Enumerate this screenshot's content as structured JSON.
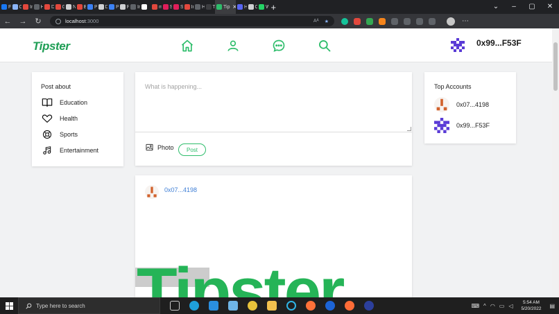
{
  "browser": {
    "tabs": [
      {
        "label": "Fa",
        "color": "#1877f2"
      },
      {
        "label": "Cc",
        "color": "#8ab4f8"
      },
      {
        "label": "In",
        "color": "#e2483d"
      },
      {
        "label": "H",
        "color": "#5f6368"
      },
      {
        "label": "Di",
        "color": "#e2483d"
      },
      {
        "label": "G",
        "color": "#e2483d"
      },
      {
        "label": "N",
        "color": "#cfd0d2"
      },
      {
        "label": "Br",
        "color": "#e2483d"
      },
      {
        "label": "Pr",
        "color": "#3c82f6"
      },
      {
        "label": "Di",
        "color": "#cfd0d2"
      },
      {
        "label": "Pr",
        "color": "#3c82f6"
      },
      {
        "label": "Pr",
        "color": "#cfd0d2"
      },
      {
        "label": "In",
        "color": "#5f6368"
      },
      {
        "label": "",
        "color": "#ffffff"
      },
      {
        "label": "m",
        "color": "#e2483d"
      },
      {
        "label": "Sl",
        "color": "#e01e5a"
      },
      {
        "label": "Sl",
        "color": "#e01e5a"
      },
      {
        "label": "In",
        "color": "#e2483d"
      },
      {
        "label": "H",
        "color": "#5f6368"
      },
      {
        "label": "Ta",
        "color": "#3c3d40"
      }
    ],
    "active_tab": {
      "label": "Tip",
      "color": "#2ebd6b"
    },
    "tail_tabs": [
      {
        "label": "H",
        "color": "#5865f2"
      },
      {
        "label": "Cl",
        "color": "#cfd0d2"
      },
      {
        "label": "W",
        "color": "#25d366"
      }
    ],
    "new_tab": "+",
    "window_controls": [
      "⌄",
      "–",
      "▢",
      "✕"
    ],
    "url_host": "localhost",
    "url_port": ":3000",
    "omni_icons": [
      "Aᴬ",
      "★"
    ]
  },
  "header": {
    "logo": "Tipster",
    "user_address": "0x99...F53F"
  },
  "colors": {
    "brand_green": "#2ebd6b",
    "link_blue": "#3f7fd6"
  },
  "left_panel": {
    "title": "Post about",
    "topics": [
      {
        "label": "Education",
        "icon": "book-icon"
      },
      {
        "label": "Health",
        "icon": "heart-icon"
      },
      {
        "label": "Sports",
        "icon": "lifebuoy-icon"
      },
      {
        "label": "Entertainment",
        "icon": "music-note-icon"
      }
    ]
  },
  "compose": {
    "placeholder": "What is happening...",
    "photo_label": "Photo",
    "post_label": "Post"
  },
  "feed": {
    "post_author": "0x07...4198",
    "image_text": "Tipster"
  },
  "right_panel": {
    "title": "Top Accounts",
    "accounts": [
      "0x07...4198",
      "0x99...F53F"
    ]
  },
  "taskbar": {
    "search_placeholder": "Type here to search",
    "time": "5:54 AM",
    "date": "5/20/2022"
  }
}
